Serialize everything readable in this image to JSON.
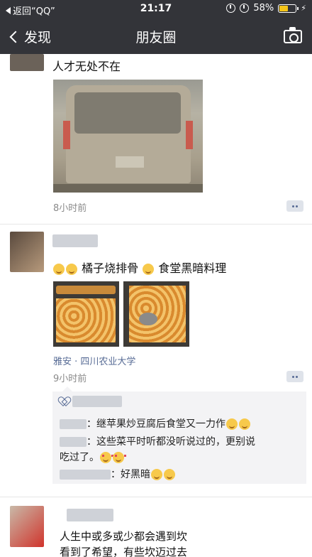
{
  "status_bar": {
    "back_app": "返回“QQ”",
    "time": "21:17",
    "battery": "58%",
    "battery_level": 0.58
  },
  "nav": {
    "back_label": "发现",
    "title": "朋友圈"
  },
  "posts": [
    {
      "text": "人才无处不在",
      "time": "8小时前"
    },
    {
      "text": "橘子烧排骨",
      "text2": "食堂黑暗料理",
      "location": "雅安 · 四川农业大学",
      "time": "9小时前",
      "comments": [
        {
          "text": "：继苹果炒豆腐后食堂又一力作"
        },
        {
          "text": "：这些菜平时听都没听说过的，更别说"
        },
        {
          "text": "吃过了。"
        },
        {
          "text": "：好黑暗"
        }
      ]
    },
    {
      "text": "人生中或多或少都会遇到坎",
      "text2": "看到了希望，有些坎迈过去"
    }
  ],
  "colors": {
    "nav_bg": "#333439",
    "link": "#576b95",
    "time_text": "#8a8a8a"
  }
}
